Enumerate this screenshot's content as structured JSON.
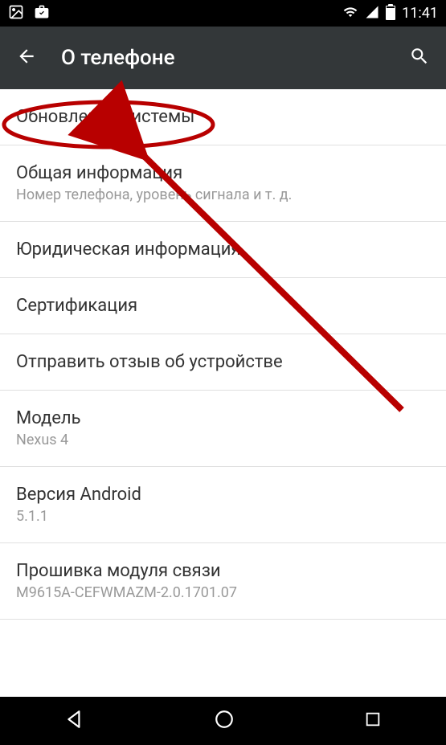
{
  "status_bar": {
    "time": "11:41"
  },
  "header": {
    "title": "О телефоне"
  },
  "items": [
    {
      "title": "Обновление системы",
      "subtitle": null
    },
    {
      "title": "Общая информация",
      "subtitle": "Номер телефона, уровень сигнала и т. д."
    },
    {
      "title": "Юридическая информация",
      "subtitle": null
    },
    {
      "title": "Сертификация",
      "subtitle": null
    },
    {
      "title": "Отправить отзыв об устройстве",
      "subtitle": null
    },
    {
      "title": "Модель",
      "subtitle": "Nexus 4"
    },
    {
      "title": "Версия Android",
      "subtitle": "5.1.1"
    },
    {
      "title": "Прошивка модуля связи",
      "subtitle": "M9615A-CEFWMAZM-2.0.1701.07"
    }
  ]
}
